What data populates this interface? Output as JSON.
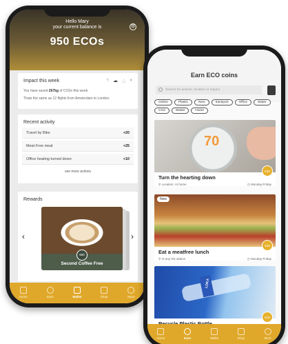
{
  "phone1": {
    "greeting": "Hello Mary",
    "balance_label": "your current balance is",
    "balance": "950 ECOs",
    "impact": {
      "title": "Impact this week",
      "saved_prefix": "You have saved ",
      "saved_amount": "267kg",
      "saved_suffix": " of CO2e this week.",
      "comparison": "Thats the same as 12 flights from Amsterdam to London."
    },
    "activity": {
      "title": "Recent activity",
      "items": [
        {
          "label": "Travel by Bike",
          "points": "+20"
        },
        {
          "label": "Meat Free meal",
          "points": "+25"
        },
        {
          "label": "Office heating turned down",
          "points": "+10"
        }
      ],
      "see_more": "see more actions"
    },
    "rewards": {
      "title": "Rewards",
      "badge": "€80",
      "name": "Second Coffee Free"
    },
    "tabs": [
      "Home",
      "Earn",
      "Wallet",
      "Shop",
      "More"
    ]
  },
  "phone2": {
    "title": "Earn ECO coins",
    "search_placeholder": "Search for actions, location or impact",
    "chips": [
      "Online",
      "Plastic",
      "New",
      "transport",
      "Office",
      "Water",
      "CO2",
      "Waste",
      "Home"
    ],
    "actions": [
      {
        "name": "Turn the hearting down",
        "location": "Location: At home",
        "schedule": "Monday-Friday",
        "coins": "€30",
        "number": "70"
      },
      {
        "name": "Eat a meatfree lunch",
        "location": "At any NS station",
        "schedule": "Monday-Friday",
        "coins": "€30",
        "badge": "New"
      },
      {
        "name": "Recycle Plastic Bottle",
        "coins": "€15",
        "label": "LOKA"
      }
    ],
    "tabs": [
      "Home",
      "Earn",
      "Wallet",
      "Shop",
      "More"
    ]
  },
  "colors": {
    "accent": "#e0a82a",
    "header_dark": "#3a3428",
    "header_gold": "#b08e38"
  }
}
